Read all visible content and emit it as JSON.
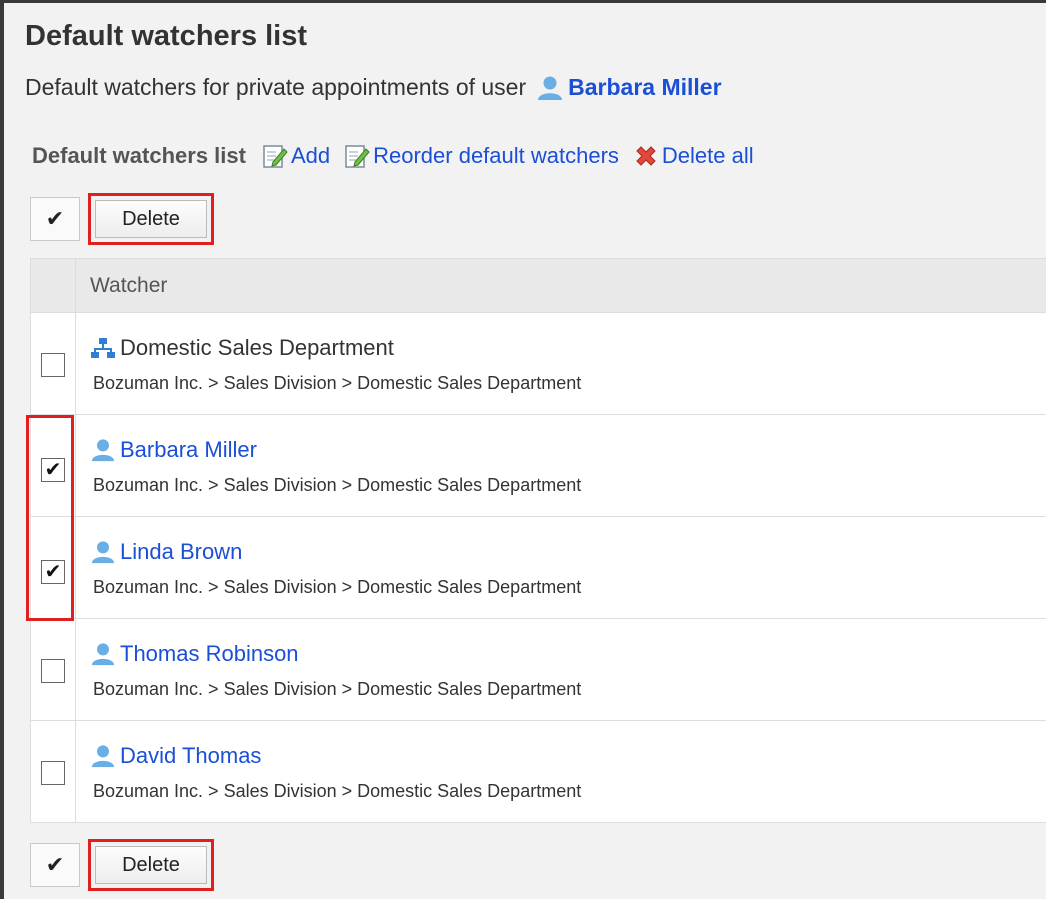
{
  "page": {
    "title": "Default watchers list",
    "subtitle_prefix": "Default watchers for private appointments of user",
    "subtitle_user": "Barbara Miller"
  },
  "toolbar": {
    "section_label": "Default watchers list",
    "add_label": "Add",
    "reorder_label": "Reorder default watchers",
    "delete_all_label": "Delete all",
    "icons": [
      "edit-icon",
      "edit-icon",
      "x-icon"
    ]
  },
  "controls": {
    "check_all_glyph": "✔",
    "delete_label": "Delete"
  },
  "table": {
    "header": "Watcher",
    "rows": [
      {
        "name": "Domestic Sales Department",
        "type": "organization",
        "icon": "org-chart-icon",
        "path": "Bozuman Inc. > Sales Division > Domestic Sales Department",
        "checked": false
      },
      {
        "name": "Barbara Miller",
        "type": "user",
        "icon": "user-icon",
        "path": "Bozuman Inc. > Sales Division > Domestic Sales Department",
        "checked": true
      },
      {
        "name": "Linda Brown",
        "type": "user",
        "icon": "user-icon",
        "path": "Bozuman Inc. > Sales Division > Domestic Sales Department",
        "checked": true
      },
      {
        "name": "Thomas Robinson",
        "type": "user",
        "icon": "user-icon",
        "path": "Bozuman Inc. > Sales Division > Domestic Sales Department",
        "checked": false
      },
      {
        "name": "David Thomas",
        "type": "user",
        "icon": "user-icon",
        "path": "Bozuman Inc. > Sales Division > Domestic Sales Department",
        "checked": false
      }
    ]
  },
  "colors": {
    "link": "#1a4fd6",
    "highlight": "#e02020",
    "background": "#f2f2f2",
    "user_icon": "#6aaee6",
    "org_icon": "#2f7fd3"
  }
}
